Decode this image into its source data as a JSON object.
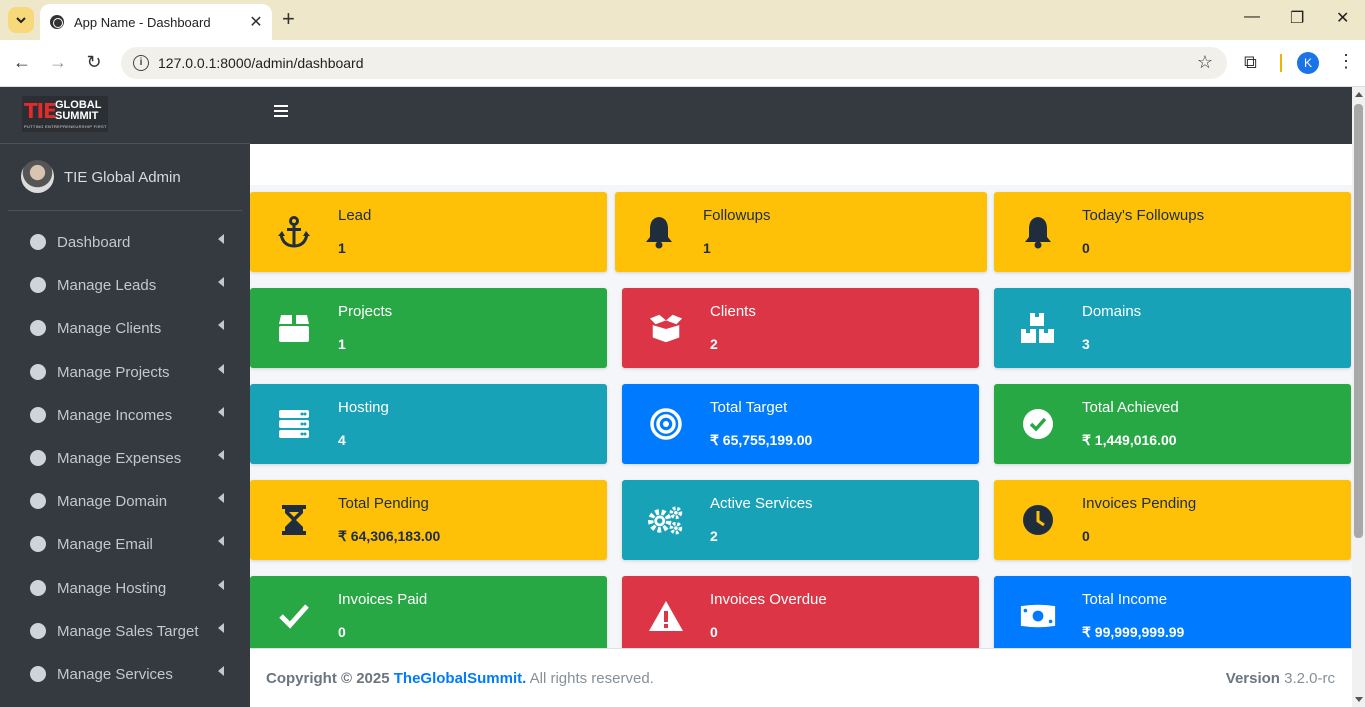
{
  "browser": {
    "tab_title": "App Name - Dashboard",
    "url": "127.0.0.1:8000/admin/dashboard",
    "profile_initial": "K"
  },
  "brand": {
    "logo_mark": "TIE",
    "logo_line1": "GLOBAL",
    "logo_line2": "SUMMIT",
    "logo_tagline": "PUTTING ENTREPRENEURSHIP FIRST"
  },
  "user": {
    "name": "TIE Global Admin"
  },
  "sidebar": {
    "items": [
      {
        "label": "Dashboard"
      },
      {
        "label": "Manage Leads"
      },
      {
        "label": "Manage Clients"
      },
      {
        "label": "Manage Projects"
      },
      {
        "label": "Manage Incomes"
      },
      {
        "label": "Manage Expenses"
      },
      {
        "label": "Manage Domain"
      },
      {
        "label": "Manage Email"
      },
      {
        "label": "Manage Hosting"
      },
      {
        "label": "Manage Sales Target"
      },
      {
        "label": "Manage Services"
      }
    ]
  },
  "boxes": [
    {
      "title": "Lead",
      "value": "1",
      "color": "#ffc107",
      "icon": "anchor-icon"
    },
    {
      "title": "Followups",
      "value": "1",
      "color": "#ffc107",
      "icon": "bell-icon"
    },
    {
      "title": "Today's Followups",
      "value": "0",
      "color": "#ffc107",
      "icon": "bell-icon"
    },
    {
      "title": "Projects",
      "value": "1",
      "color": "#28a745",
      "icon": "box-icon"
    },
    {
      "title": "Clients",
      "value": "2",
      "color": "#dc3545",
      "icon": "box-open-icon"
    },
    {
      "title": "Domains",
      "value": "3",
      "color": "#17a2b8",
      "icon": "boxes-icon"
    },
    {
      "title": "Hosting",
      "value": "4",
      "color": "#17a2b8",
      "icon": "server-icon"
    },
    {
      "title": "Total Target",
      "value": "₹ 65,755,199.00",
      "color": "#007bff",
      "icon": "bullseye-icon"
    },
    {
      "title": "Total Achieved",
      "value": "₹ 1,449,016.00",
      "color": "#28a745",
      "icon": "check-circle-icon"
    },
    {
      "title": "Total Pending",
      "value": "₹ 64,306,183.00",
      "color": "#ffc107",
      "icon": "hourglass-icon"
    },
    {
      "title": "Active Services",
      "value": "2",
      "color": "#17a2b8",
      "icon": "cogs-icon"
    },
    {
      "title": "Invoices Pending",
      "value": "0",
      "color": "#ffc107",
      "icon": "clock-icon"
    },
    {
      "title": "Invoices Paid",
      "value": "0",
      "color": "#28a745",
      "icon": "check-icon"
    },
    {
      "title": "Invoices Overdue",
      "value": "0",
      "color": "#dc3545",
      "icon": "warning-icon"
    },
    {
      "title": "Total Income",
      "value": "₹ 99,999,999.99",
      "color": "#007bff",
      "icon": "money-bill-icon"
    }
  ],
  "footer": {
    "copyright_prefix": "Copyright © 2025",
    "company": "TheGlobalSummit.",
    "rights": "All rights reserved.",
    "version_label": "Version",
    "version_number": "3.2.0-rc"
  }
}
